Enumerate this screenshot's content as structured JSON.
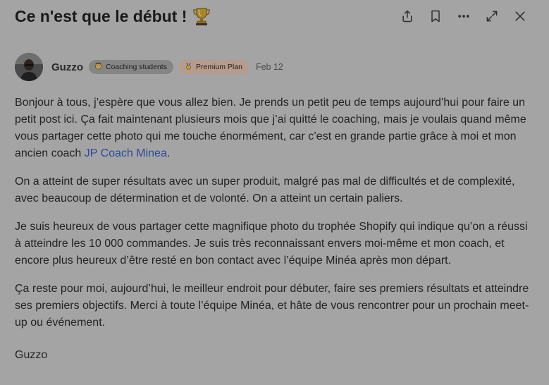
{
  "post": {
    "title": "Ce n'est que le début !",
    "title_emoji": "trophy-icon"
  },
  "header_actions": [
    {
      "name": "share-icon"
    },
    {
      "name": "bookmark-icon"
    },
    {
      "name": "more-icon"
    },
    {
      "name": "expand-icon"
    },
    {
      "name": "close-icon"
    }
  ],
  "author": {
    "name": "Guzzo",
    "badges": [
      {
        "label": "Coaching students",
        "icon": "coaching-badge-icon"
      },
      {
        "label": "Premium Plan",
        "icon": "premium-badge-icon"
      }
    ],
    "date": "Feb 12"
  },
  "body": {
    "p1_text": "Bonjour à tous, j’espère que vous allez bien. Je prends un petit peu de temps aujourd’hui pour faire un petit post ici. Ça fait maintenant plusieurs mois que j’ai quitté le coaching, mais je voulais quand même vous partager cette photo qui me touche énormément, car c’est en grande partie grâce à moi et mon ancien coach ",
    "p1_link": "JP Coach Minea",
    "p1_end": ".",
    "p2": "On a atteint de super résultats avec un super produit, malgré pas mal de difficultés et de complexité, avec beaucoup de détermination et de volonté. On a atteint un certain paliers.",
    "p3": "Je suis heureux de vous partager cette magnifique photo du trophée Shopify qui indique qu’on a réussi à atteindre les 10 000 commandes. Je suis très reconnaissant envers moi-même et mon coach, et encore plus heureux d’être resté en bon contact avec l’équipe Minéa après mon départ.",
    "p4": "Ça reste pour moi, aujourd’hui, le meilleur endroit pour débuter, faire ses premiers résultats et atteindre ses premiers objectifs. Merci à toute l’équipe Minéa, et hâte de vous rencontrer pour un prochain meet-up ou événement.",
    "signature": "Guzzo"
  },
  "colors": {
    "background": "#a4a4a4",
    "link": "#2c4a9e",
    "coaching_badge": "#858585",
    "premium_badge": "#b79b8c"
  }
}
